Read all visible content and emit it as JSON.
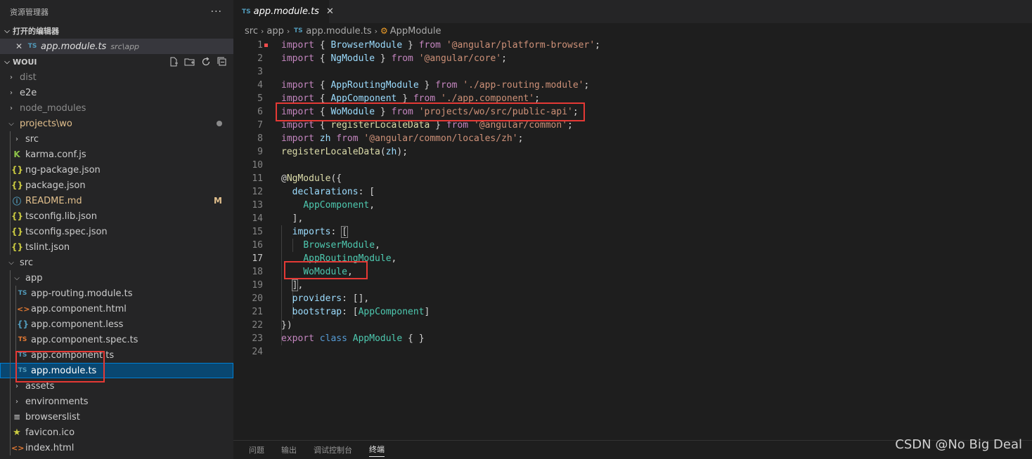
{
  "sidebar": {
    "title": "资源管理器",
    "more_label": "···",
    "open_editors": {
      "title": "打开的编辑器",
      "items": [
        {
          "icon": "TS",
          "name": "app.module.ts",
          "path": "src\\app"
        }
      ]
    },
    "project": {
      "title": "WOUI",
      "actions": [
        "new-file-icon",
        "new-folder-icon",
        "refresh-icon",
        "collapse-all-icon"
      ]
    },
    "tree": {
      "dist": "dist",
      "e2e": "e2e",
      "node_modules": "node_modules",
      "projects_wo": "projects\\wo",
      "src_lib": "src",
      "karma": "karma.conf.js",
      "ng_package": "ng-package.json",
      "package": "package.json",
      "readme": "README.md",
      "readme_badge": "M",
      "tsconfig_lib": "tsconfig.lib.json",
      "tsconfig_spec": "tsconfig.spec.json",
      "tslint": "tslint.json",
      "src": "src",
      "app": "app",
      "app_routing": "app-routing.module.ts",
      "app_html": "app.component.html",
      "app_less": "app.component.less",
      "app_spec": "app.component.spec.ts",
      "app_component": "app.component.ts",
      "app_module": "app.module.ts",
      "assets": "assets",
      "environments": "environments",
      "browserslist": "browserslist",
      "favicon": "favicon.ico",
      "index": "index.html"
    },
    "icons": {
      "ts": "TS",
      "json": "{}",
      "html": "<>",
      "less": "{}",
      "info": "ⓘ",
      "karma": "K",
      "star": "★",
      "lines": "≡"
    }
  },
  "editor": {
    "tab": {
      "icon": "TS",
      "name": "app.module.ts",
      "close": "✕"
    },
    "breadcrumb": [
      "src",
      "app",
      "app.module.ts",
      "AppModule"
    ],
    "code": {
      "l1_from": "from",
      "l1_str": "'@angular/platform-browser'",
      "l2_str": "'@angular/core'",
      "l4_str": "'./app-routing.module'",
      "l5_str": "'./app.component'",
      "l6_str": "'projects/wo/src/public-api'",
      "l7_str": "'@angular/common'",
      "l8_str": "'@angular/common/locales/zh'"
    }
  },
  "panel": {
    "tabs": [
      "问题",
      "输出",
      "调试控制台",
      "终端"
    ]
  },
  "watermark": "CSDN @No Big Deal"
}
